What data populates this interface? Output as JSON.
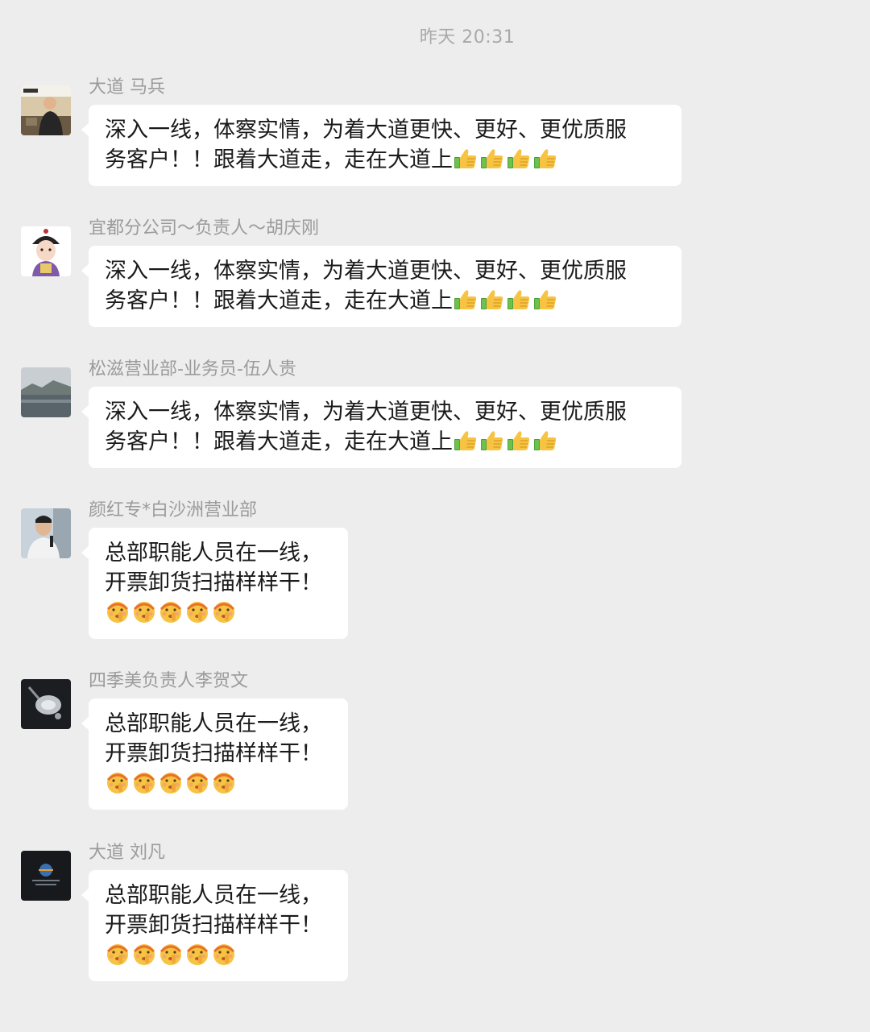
{
  "timestamp": "昨天 20:31",
  "messages": [
    {
      "sender": "大道 马兵",
      "avatar_icon": "man-at-desk-photo-avatar",
      "line1": "深入一线，体察实情，为着大道更快、更好、更优质服",
      "line2": "务客户！！跟着大道走，走在大道上",
      "emoji": "thumbs-up-icon",
      "emoji_count": 4
    },
    {
      "sender": "宜都分公司～负责人～胡庆刚",
      "avatar_icon": "cartoon-official-avatar",
      "line1": "深入一线，体察实情，为着大道更快、更好、更优质服",
      "line2": "务客户！！跟着大道走，走在大道上",
      "emoji": "thumbs-up-icon",
      "emoji_count": 4
    },
    {
      "sender": "松滋营业部-业务员-伍人贵",
      "avatar_icon": "lake-landscape-avatar",
      "line1": "深入一线，体察实情，为着大道更快、更好、更优质服",
      "line2": "务客户！！跟着大道走，走在大道上",
      "emoji": "thumbs-up-icon",
      "emoji_count": 4
    },
    {
      "sender": "颜红专*白沙洲营业部",
      "avatar_icon": "man-with-microphone-avatar",
      "line1": "总部职能人员在一线，",
      "line2": "开票卸货扫描样样干！",
      "emoji": "hushed-face-icon",
      "emoji_count": 5
    },
    {
      "sender": "四季美负责人李贺文",
      "avatar_icon": "silver-ornament-avatar",
      "line1": "总部职能人员在一线，",
      "line2": "开票卸货扫描样样干！",
      "emoji": "hushed-face-icon",
      "emoji_count": 5
    },
    {
      "sender": "大道 刘凡",
      "avatar_icon": "dark-logo-avatar",
      "line1": "总部职能人员在一线，",
      "line2": "开票卸货扫描样样干！",
      "emoji": "hushed-face-icon",
      "emoji_count": 5
    }
  ],
  "colors": {
    "background": "#ededed",
    "bubble": "#ffffff",
    "sender_text": "#9b9b9b",
    "message_text": "#1a1a1a"
  }
}
